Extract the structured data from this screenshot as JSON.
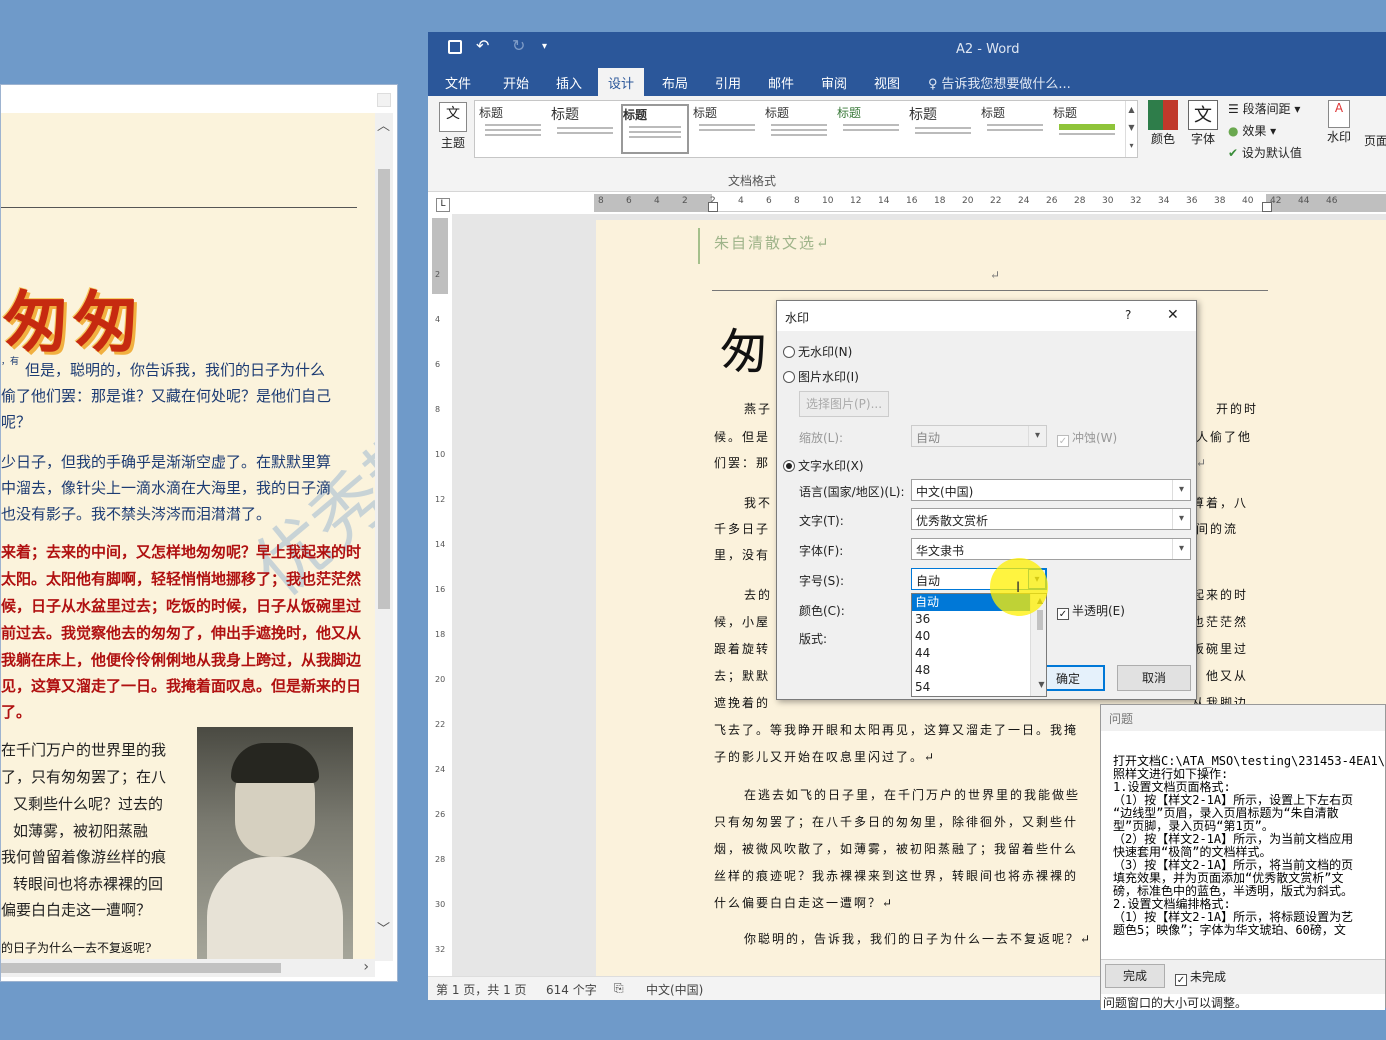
{
  "sample": {
    "title": "匆匆",
    "watermark": "优秀散文赏析",
    "p1": [
      "，有",
      "但是，聪明的，你告诉我，我们的日子为什么",
      "偷了他们罢：那是谁？又藏在何处呢？是他们自己",
      "呢？"
    ],
    "p2": [
      "少日子，但我的手确乎是渐渐空虚了。在默默里算",
      "中溜去，像针尖上一滴水滴在大海里，我的日子滴",
      "也没有影子。我不禁头涔涔而泪潸潸了。"
    ],
    "p3": [
      "来着；去来的中间，又怎样地匆匆呢？早上我起来的时",
      "太阳。太阳他有脚啊，轻轻悄悄地挪移了；我也茫茫然",
      "候，日子从水盆里过去；吃饭的时候，日子从饭碗里过",
      "前过去。我觉察他去的匆匆了，伸出手遮挽时，他又从",
      "我躺在床上，他便伶伶俐俐地从我身上跨过，从我脚边",
      "见，这算又溜走了一日。我掩着面叹息。但是新来的日",
      "了。"
    ],
    "p4": [
      "在千门万户的世界里的我",
      "了，只有匆匆罢了；在八",
      "又剩些什么呢？过去的",
      "如薄雾，被初阳蒸融",
      "我何曾留着像游丝样的痕",
      "转眼间也将赤裸裸的回",
      "偏要白白走这一遭啊？"
    ],
    "last": "的日子为什么一去不复返呢?"
  },
  "word": {
    "title": "A2 - Word",
    "tabs": [
      "文件",
      "开始",
      "插入",
      "设计",
      "布局",
      "引用",
      "邮件",
      "审阅",
      "视图"
    ],
    "tell_me": "告诉我您想要做什么...",
    "theme_label": "主题",
    "gallery_label": "文档格式",
    "gallery_items": [
      "标题",
      "标题",
      "标题",
      "标题",
      "标题",
      "标题",
      "标题",
      "标题",
      "标题"
    ],
    "colors_label": "颜色",
    "fonts_label": "字体",
    "para_spacing": "段落间距",
    "effects": "效果",
    "set_default": "设为默认值",
    "watermark_btn": "水印",
    "page_color_btn": "页面",
    "ruler_numbers": [
      "8",
      "6",
      "4",
      "2",
      "2",
      "4",
      "6",
      "8",
      "10",
      "12",
      "14",
      "16",
      "18",
      "20",
      "22",
      "24",
      "26",
      "28",
      "30",
      "32",
      "34",
      "36",
      "38",
      "40",
      "42",
      "44",
      "46"
    ],
    "vruler_numbers": [
      "2",
      "4",
      "6",
      "8",
      "10",
      "12",
      "14",
      "16",
      "18",
      "20",
      "22",
      "24",
      "26",
      "28",
      "30",
      "32"
    ],
    "status": {
      "page": "第 1 页，共 1 页",
      "words": "614 个字",
      "lang": "中文(中国)"
    }
  },
  "doc": {
    "header": "朱自清散文选↵",
    "title_char": "匆",
    "lines": [
      "燕子",
      "候。但是",
      "们罢：那",
      "我不",
      "千多日子",
      "里，没有",
      "去的",
      "候，小屋",
      "跟着旋转",
      "去；默默",
      "遮挽着的",
      "飞去了。等我睁开眼和太阳再见，这算又溜走了一日。我掩",
      "子的影儿又开始在叹息里闪过了。↵",
      "在逃去如飞的日子里，在千门万户的世界里的我能做些",
      "只有匆匆罢了；在八千多日的匆匆里，除徘徊外，又剩些什",
      "烟，被微风吹散了，如薄雾，被初阳蒸融了；我留着些什么",
      "丝样的痕迹呢？我赤裸裸来到这世界，转眼间也将赤裸裸的",
      "什么偏要白白走这一遭啊？↵",
      "你聪明的，告诉我，我们的日子为什么一去不复返呢？↵"
    ],
    "right_frags": [
      "开的时",
      "人偷了他",
      "↵",
      "算着，八",
      "间的流",
      "起来的时",
      "也茫茫然",
      "饭碗里过",
      "，他又从",
      "从我脚边"
    ]
  },
  "dialog": {
    "title": "水印",
    "help": "?",
    "close": "✕",
    "no_wm": "无水印(N)",
    "pic_wm": "图片水印(I)",
    "choose_pic": "选择图片(P)...",
    "scale_label": "缩放(L):",
    "scale_value": "自动",
    "washout": "冲蚀(W)",
    "text_wm": "文字水印(X)",
    "lang_label": "语言(国家/地区)(L):",
    "lang_value": "中文(中国)",
    "text_label": "文字(T):",
    "text_value": "优秀散文赏析",
    "font_label": "字体(F):",
    "font_value": "华文隶书",
    "size_label": "字号(S):",
    "size_value": "自动",
    "color_label": "颜色(C):",
    "semi": "半透明(E)",
    "layout_label": "版式:",
    "ok": "确定",
    "cancel": "取消",
    "size_options": [
      "自动",
      "36",
      "40",
      "44",
      "48",
      "54"
    ]
  },
  "question": {
    "header": "问题",
    "lines": [
      "打开文档C:\\ATA_MSO\\testing\\231453-4EA1\\",
      "照样文进行如下操作:",
      "1.设置文档页面格式:",
      "（1）按【样文2-1A】所示，设置上下左右页",
      "“边线型”页眉，录入页眉标题为“朱自清散",
      "型”页脚，录入页码“第1页”。",
      "（2）按【样文2-1A】所示，为当前文档应用",
      "快速套用“极简”的文档样式。",
      "（3）按【样文2-1A】所示，将当前文档的页",
      "填充效果，并为页面添加“优秀散文赏析”文",
      "磅，标准色中的蓝色，半透明，版式为斜式。",
      "2.设置文档编排格式:",
      "（1）按【样文2-1A】所示，将标题设置为艺",
      "题色5；映像”；字体为华文琥珀、60磅，文"
    ],
    "done": "完成",
    "incomplete": "未完成",
    "footer": "问题窗口的大小可以调整。"
  }
}
